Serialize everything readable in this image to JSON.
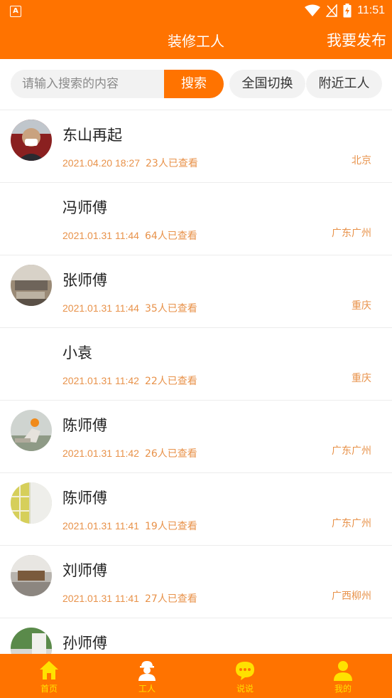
{
  "status_bar": {
    "time": "11:51",
    "app_icon_letter": "A"
  },
  "header": {
    "title": "装修工人",
    "publish": "我要发布"
  },
  "search": {
    "placeholder": "请输入搜索的内容",
    "button": "搜索",
    "nationwide": "全国切换",
    "nearby": "附近工人"
  },
  "workers": [
    {
      "name": "东山再起",
      "time": "2021.04.20 18:27",
      "views": "23人已查看",
      "location": "北京",
      "avatar": "photo"
    },
    {
      "name": "冯师傅",
      "time": "2021.01.31 11:44",
      "views": "64人已查看",
      "location": "广东广州",
      "avatar": "none"
    },
    {
      "name": "张师傅",
      "time": "2021.01.31 11:44",
      "views": "35人已查看",
      "location": "重庆",
      "avatar": "photo"
    },
    {
      "name": "小袁",
      "time": "2021.01.31 11:42",
      "views": "22人已查看",
      "location": "重庆",
      "avatar": "none"
    },
    {
      "name": "陈师傅",
      "time": "2021.01.31 11:42",
      "views": "26人已查看",
      "location": "广东广州",
      "avatar": "photo"
    },
    {
      "name": "陈师傅",
      "time": "2021.01.31 11:41",
      "views": "19人已查看",
      "location": "广东广州",
      "avatar": "photo"
    },
    {
      "name": "刘师傅",
      "time": "2021.01.31 11:41",
      "views": "27人已查看",
      "location": "广西柳州",
      "avatar": "photo"
    },
    {
      "name": "孙师傅",
      "time": "",
      "views": "",
      "location": "",
      "avatar": "photo"
    }
  ],
  "tabs": [
    {
      "label": "首页",
      "icon": "home-icon"
    },
    {
      "label": "工人",
      "icon": "worker-icon"
    },
    {
      "label": "说说",
      "icon": "chat-icon"
    },
    {
      "label": "我的",
      "icon": "profile-icon"
    }
  ],
  "colors": {
    "brand": "#ff7300",
    "meta_text": "#e8924a",
    "tab_label": "#ffe100"
  }
}
